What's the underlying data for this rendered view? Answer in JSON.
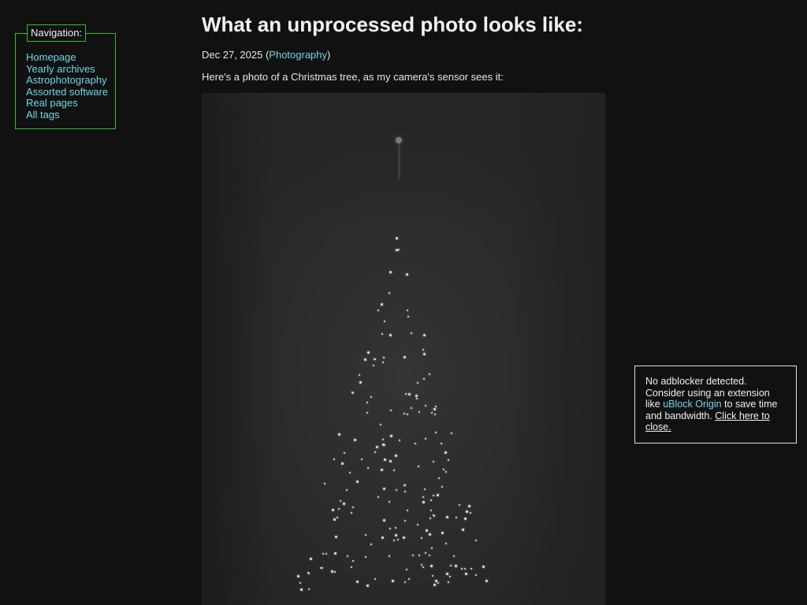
{
  "navigation": {
    "legend": "Navigation:",
    "items": [
      {
        "label": "Homepage"
      },
      {
        "label": "Yearly archives"
      },
      {
        "label": "Astrophotography"
      },
      {
        "label": "Assorted software"
      },
      {
        "label": "Real pages"
      },
      {
        "label": "All tags"
      }
    ]
  },
  "article": {
    "title": "What an unprocessed photo looks like:",
    "date": "Dec 27, 2025",
    "open_paren": " (",
    "tag": "Photography",
    "close_paren": ")",
    "intro": "Here's a photo of a Christmas tree, as my camera's sensor sees it:"
  },
  "notice": {
    "line1": "No adblocker detected.",
    "line2_prefix": "Consider using an extension like ",
    "extension_link": "uBlock Origin",
    "line2_suffix": " to save time and bandwidth. ",
    "close_link": "Click here to close."
  },
  "colors": {
    "background": "#111111",
    "nav_border": "#2fbf2f",
    "link": "#6fd6e6",
    "text": "#e6e6e6"
  }
}
